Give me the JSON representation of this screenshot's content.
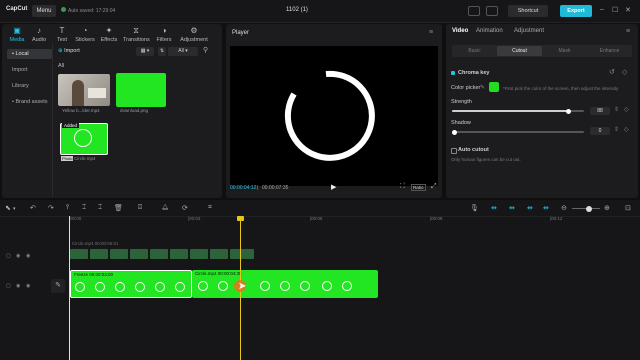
{
  "app": {
    "name": "CapCut",
    "menu_label": "Menu",
    "autosave": "Auto saved: 17:29:04",
    "project_title": "1102 (1)"
  },
  "header": {
    "shortcut_label": "Shortcut",
    "export_label": "Export"
  },
  "media_tabs": [
    {
      "label": "Media",
      "icon": "media-icon"
    },
    {
      "label": "Audio",
      "icon": "audio-icon"
    },
    {
      "label": "Text",
      "icon": "text-icon"
    },
    {
      "label": "Stickers",
      "icon": "stickers-icon"
    },
    {
      "label": "Effects",
      "icon": "effects-icon"
    },
    {
      "label": "Transitions",
      "icon": "transitions-icon"
    },
    {
      "label": "Filters",
      "icon": "filters-icon"
    },
    {
      "label": "Adjustment",
      "icon": "adjustment-icon"
    }
  ],
  "media_sidebar": [
    "• Local",
    "Import",
    "Library",
    "• Brand assets"
  ],
  "media": {
    "import_label": "Import",
    "all_label": "All",
    "all_filter": "All",
    "sort_label": "Sort",
    "items": [
      {
        "caption": "Yellow b...lder.mp4",
        "badge": ""
      },
      {
        "caption": "download.png",
        "badge": ""
      },
      {
        "caption": "Circle.mp4",
        "badge": "Photo",
        "overlay": "Added"
      }
    ]
  },
  "player": {
    "title": "Player",
    "time_current": "00:00:04:12",
    "time_total": "00:00:07:35",
    "ratio_label": "Ratio"
  },
  "inspector": {
    "tabs": [
      "Video",
      "Animation",
      "Adjustment"
    ],
    "sub_tabs": [
      "Basic",
      "Cutout",
      "Mask",
      "Enhance"
    ],
    "chroma_key_label": "Chroma key",
    "color_picker_label": "Color picker",
    "picker_color": "#22dd22",
    "picker_hint": "*First pick the color of the screen, then adjust the intensity",
    "strength_label": "Strength",
    "strength_value": "88",
    "strength_level": 0.88,
    "shadow_label": "Shadow",
    "shadow_value": "0",
    "shadow_level": 0,
    "auto_cutout_label": "Auto cutout",
    "auto_cutout_hint": "Only human figures can be cut out."
  },
  "timeline": {
    "ruler": [
      "00:00",
      "|00:03",
      "|00:06",
      "|00:09",
      "|00:12"
    ],
    "ghost_clip_label": "Circle.mp4  00:00:06:01",
    "freeze_label": "Freeze   00:00:03:00",
    "clip_label": "Circle.mp4   00:00:04:35"
  },
  "colors": {
    "accent": "#1fc4e3",
    "green": "#22e622",
    "playhead": "#e6c619"
  }
}
